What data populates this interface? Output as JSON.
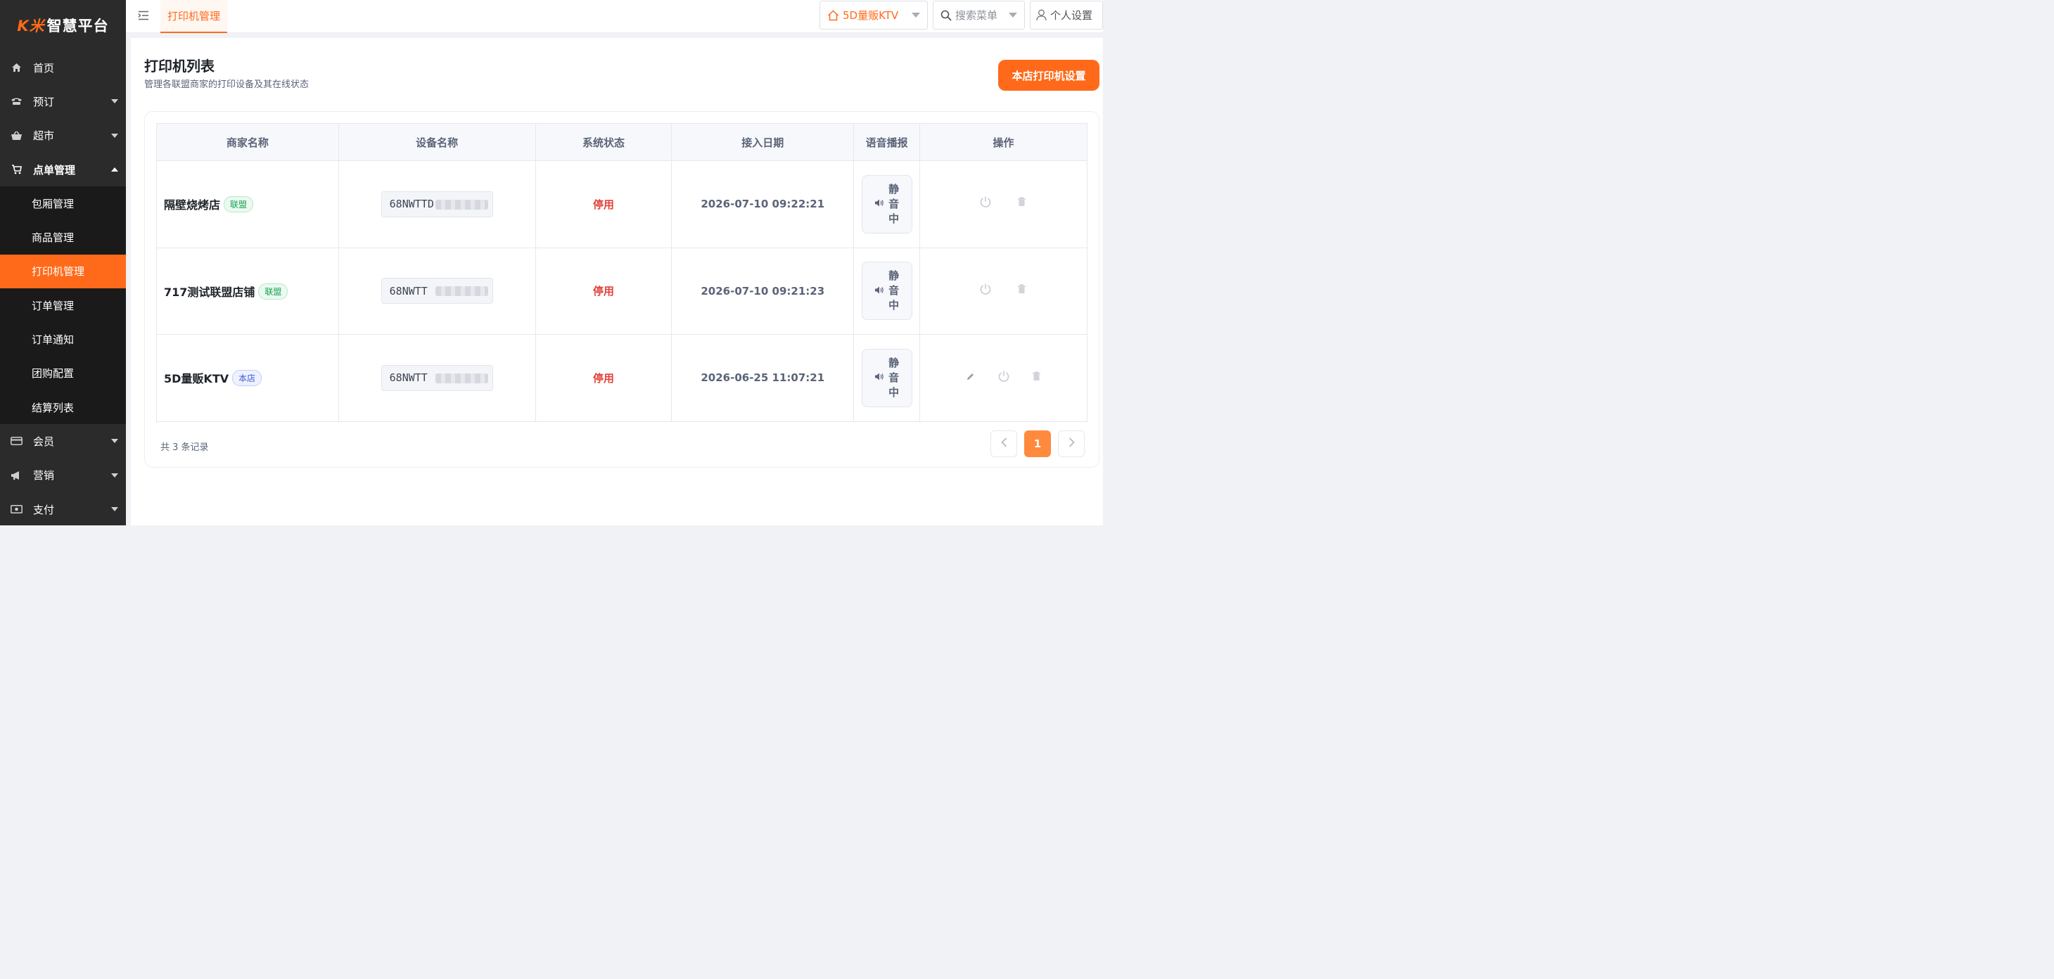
{
  "logo": {
    "brand": "K米",
    "name": "智慧平台"
  },
  "sidebar": {
    "items": [
      {
        "label": "首页",
        "icon": "home-icon"
      },
      {
        "label": "预订",
        "icon": "phone-icon"
      },
      {
        "label": "超市",
        "icon": "basket-icon"
      },
      {
        "label": "点单管理",
        "icon": "cart-icon"
      }
    ],
    "sub_items": [
      {
        "label": "包厢管理"
      },
      {
        "label": "商品管理"
      },
      {
        "label": "打印机管理"
      },
      {
        "label": "订单管理"
      },
      {
        "label": "订单通知"
      },
      {
        "label": "团购配置"
      },
      {
        "label": "结算列表"
      }
    ],
    "bottom_items": [
      {
        "label": "会员",
        "icon": "card-icon"
      },
      {
        "label": "营销",
        "icon": "megaphone-icon"
      },
      {
        "label": "支付",
        "icon": "money-icon"
      }
    ]
  },
  "header": {
    "active_tab": "打印机管理",
    "store_select": "5D量贩KTV",
    "search_placeholder": "搜索菜单",
    "user_settings": "个人设置"
  },
  "page": {
    "title": "打印机列表",
    "subtitle": "管理各联盟商家的打印设备及其在线状态",
    "primary_button": "本店打印机设置"
  },
  "table": {
    "headers": {
      "merchant": "商家名称",
      "device": "设备名称",
      "status": "系统状态",
      "date": "接入日期",
      "voice": "语音播报",
      "ops": "操作"
    },
    "rows": [
      {
        "merchant": "隔壁烧烤店",
        "tag": "联盟",
        "device": "68NWTTD",
        "status": "停用",
        "date": "2026-07-10 09:22:21",
        "voice": "静音中"
      },
      {
        "merchant": "717测试联盟店铺",
        "tag": "联盟",
        "device": "68NWTT",
        "status": "停用",
        "date": "2026-07-10 09:21:23",
        "voice": "静音中"
      },
      {
        "merchant": "5D量贩KTV",
        "tag": "本店",
        "device": "68NWTT",
        "status": "停用",
        "date": "2026-06-25 11:07:21",
        "voice": "静音中"
      }
    ]
  },
  "footer": {
    "total": "共 3 条记录",
    "current_page": "1"
  },
  "colors": {
    "accent": "#ff6a1a",
    "sidebar": "#2b2b2b",
    "danger": "#e2433b"
  }
}
